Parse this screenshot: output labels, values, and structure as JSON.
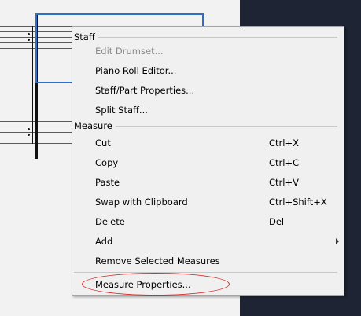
{
  "context_menu": {
    "staff_section": {
      "header": "Staff",
      "items": [
        {
          "label": "Edit Drumset...",
          "enabled": false
        },
        {
          "label": "Piano Roll Editor...",
          "enabled": true
        },
        {
          "label": "Staff/Part Properties...",
          "enabled": true
        },
        {
          "label": "Split Staff...",
          "enabled": true
        }
      ]
    },
    "measure_section": {
      "header": "Measure",
      "items": [
        {
          "label": "Cut",
          "shortcut": "Ctrl+X"
        },
        {
          "label": "Copy",
          "shortcut": "Ctrl+C"
        },
        {
          "label": "Paste",
          "shortcut": "Ctrl+V"
        },
        {
          "label": "Swap with Clipboard",
          "shortcut": "Ctrl+Shift+X"
        },
        {
          "label": "Delete",
          "shortcut": "Del"
        },
        {
          "label": "Add",
          "has_submenu": true
        },
        {
          "label": "Remove Selected Measures"
        }
      ]
    },
    "properties_item": {
      "label": "Measure Properties...",
      "annotated": true
    }
  },
  "colors": {
    "selection": "#2a6fc9",
    "annotation": "#d62a2a",
    "right_panel": "#1e2433"
  }
}
